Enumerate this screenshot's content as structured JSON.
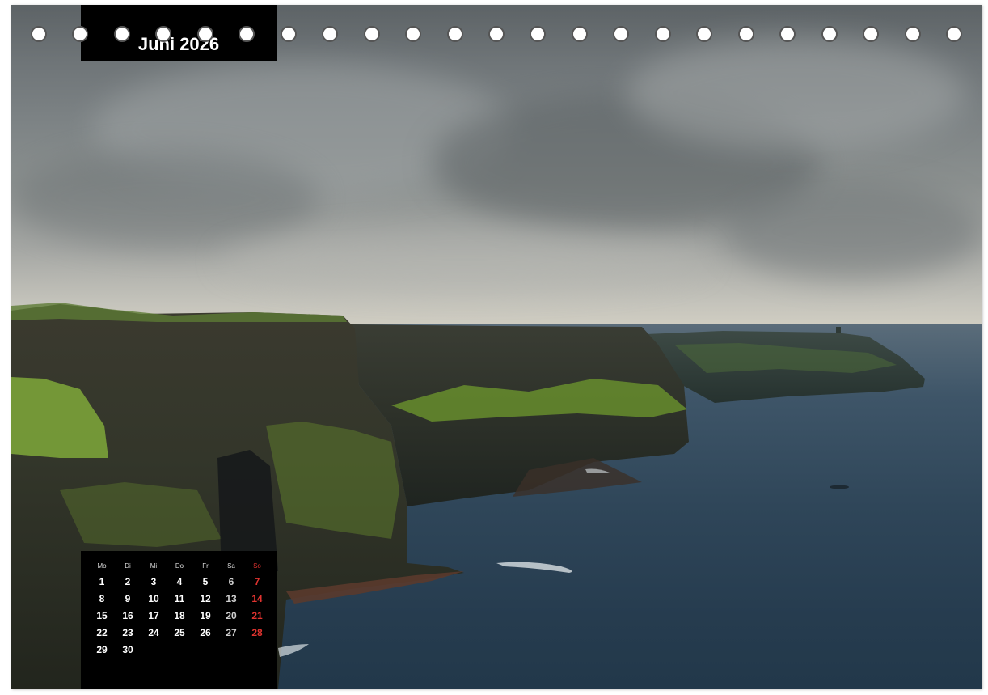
{
  "month_label": "Juni 2026",
  "calendar": {
    "weekdays": [
      "Mo",
      "Di",
      "Mi",
      "Do",
      "Fr",
      "Sa",
      "So"
    ],
    "weeks": [
      [
        "1",
        "2",
        "3",
        "4",
        "5",
        "6",
        "7"
      ],
      [
        "8",
        "9",
        "10",
        "11",
        "12",
        "13",
        "14"
      ],
      [
        "15",
        "16",
        "17",
        "18",
        "19",
        "20",
        "21"
      ],
      [
        "22",
        "23",
        "24",
        "25",
        "26",
        "27",
        "28"
      ],
      [
        "29",
        "30",
        "",
        "",
        "",
        "",
        ""
      ]
    ]
  },
  "colors": {
    "sunday": "#e0332f",
    "label_background": "#000000",
    "sea": "#2f4659",
    "cliff_grass": "#6f9a2e"
  },
  "binding_holes": 23
}
